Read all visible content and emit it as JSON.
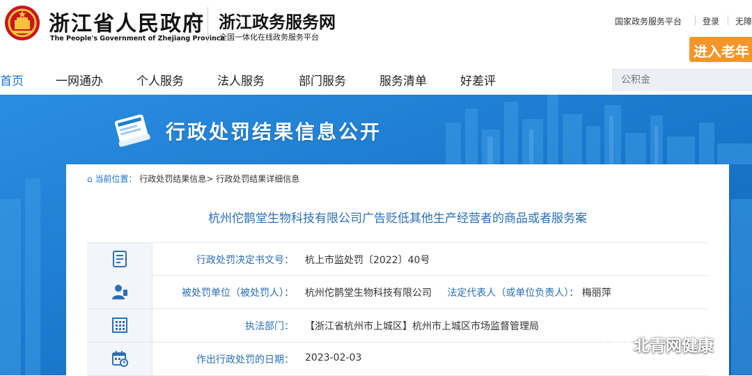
{
  "header": {
    "brand_cn": "浙江省人民政府",
    "brand_en": "The People's Government of Zhejiang Province",
    "service_cn": "浙江政务服务网",
    "service_sub": "全国一体化在线政务服务平台",
    "links": [
      "国家政务服务平台",
      "登录",
      "无障"
    ],
    "elder_button": "进入老年"
  },
  "nav": {
    "items": [
      "首页",
      "一网通办",
      "个人服务",
      "法人服务",
      "部门服务",
      "服务清单",
      "好差评"
    ],
    "active_index": 0,
    "search_placeholder": "公积金"
  },
  "banner": {
    "title": "行政处罚结果信息公开"
  },
  "breadcrumb": {
    "prefix": "当前位置：",
    "items": [
      "行政处罚结果信息",
      "行政处罚结果详细信息"
    ],
    "separator": ">"
  },
  "case": {
    "title": "杭州佗鹊堂生物科技有限公司广告贬低其他生产经营者的商品或者服务案",
    "rows": [
      {
        "icon": "document-icon",
        "label": "行政处罚决定书文号：",
        "value": "杭上市监处罚〔2022〕40号"
      },
      {
        "icon": "person-icon",
        "label": "被处罚单位（被处罚人）：",
        "value": "杭州佗鹊堂生物科技有限公司",
        "label2": "法定代表人（或单位负责人）：",
        "value2": "梅丽萍"
      },
      {
        "icon": "building-icon",
        "label": "执法部门：",
        "value": "【浙江省杭州市上城区】杭州市上城区市场监督管理局"
      },
      {
        "icon": "calendar-icon",
        "label": "作出行政处罚的日期：",
        "value": "2023-02-03"
      }
    ]
  },
  "watermark": {
    "text": "北青网健康",
    "icon": "wechat-icon"
  },
  "colors": {
    "accent": "#1a6fd1",
    "label_blue": "#2a6fb5",
    "banner_blue": "#1d7fd0",
    "elder_orange": "#f2962b",
    "emblem_red": "#c8161d"
  }
}
